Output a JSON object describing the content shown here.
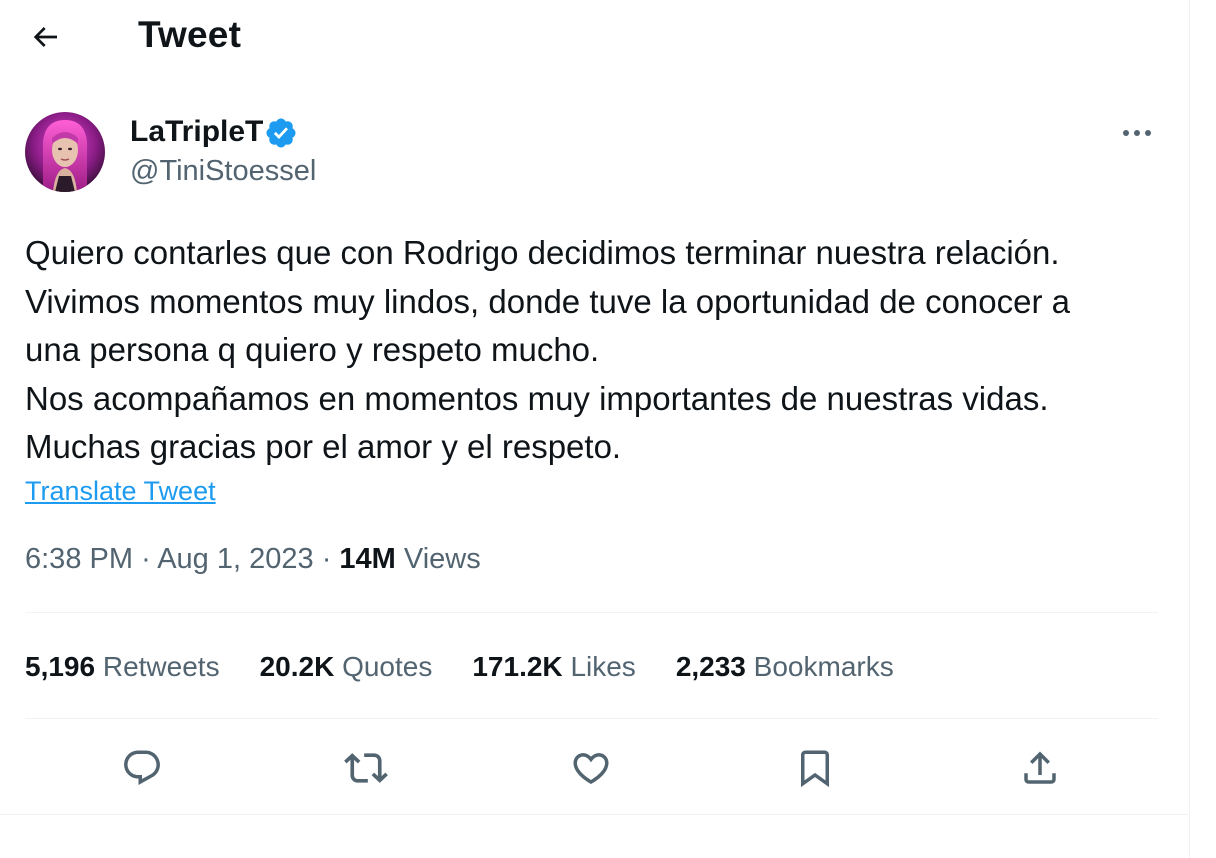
{
  "header": {
    "title": "Tweet"
  },
  "author": {
    "display_name": "LaTripleT",
    "handle": "@TiniStoessel",
    "verified": true
  },
  "tweet": {
    "lines": [
      "Quiero contarles que con Rodrigo decidimos terminar nuestra relación.",
      "Vivimos momentos muy lindos, donde tuve la oportunidad de conocer a",
      "una persona q quiero y respeto mucho.",
      "Nos acompañamos en momentos muy importantes de nuestras vidas.",
      "Muchas gracias por el amor y el respeto."
    ],
    "translate_label": "Translate Tweet",
    "time": "6:38 PM",
    "date": "Aug 1, 2023",
    "separator": "·",
    "views_count": "14M",
    "views_label": "Views"
  },
  "stats": {
    "retweets": {
      "count": "5,196",
      "label": "Retweets"
    },
    "quotes": {
      "count": "20.2K",
      "label": "Quotes"
    },
    "likes": {
      "count": "171.2K",
      "label": "Likes"
    },
    "bookmarks": {
      "count": "2,233",
      "label": "Bookmarks"
    }
  },
  "icons": {
    "back": "arrow-left-icon",
    "verified": "verified-badge-icon",
    "more": "more-dots-icon",
    "reply": "reply-icon",
    "retweet": "retweet-icon",
    "like": "heart-icon",
    "bookmark": "bookmark-icon",
    "share": "share-icon"
  },
  "colors": {
    "accent": "#1d9bf0",
    "text": "#0f1419",
    "muted": "#536471",
    "divider": "#eff3f4",
    "verified": "#1d9bf0"
  }
}
